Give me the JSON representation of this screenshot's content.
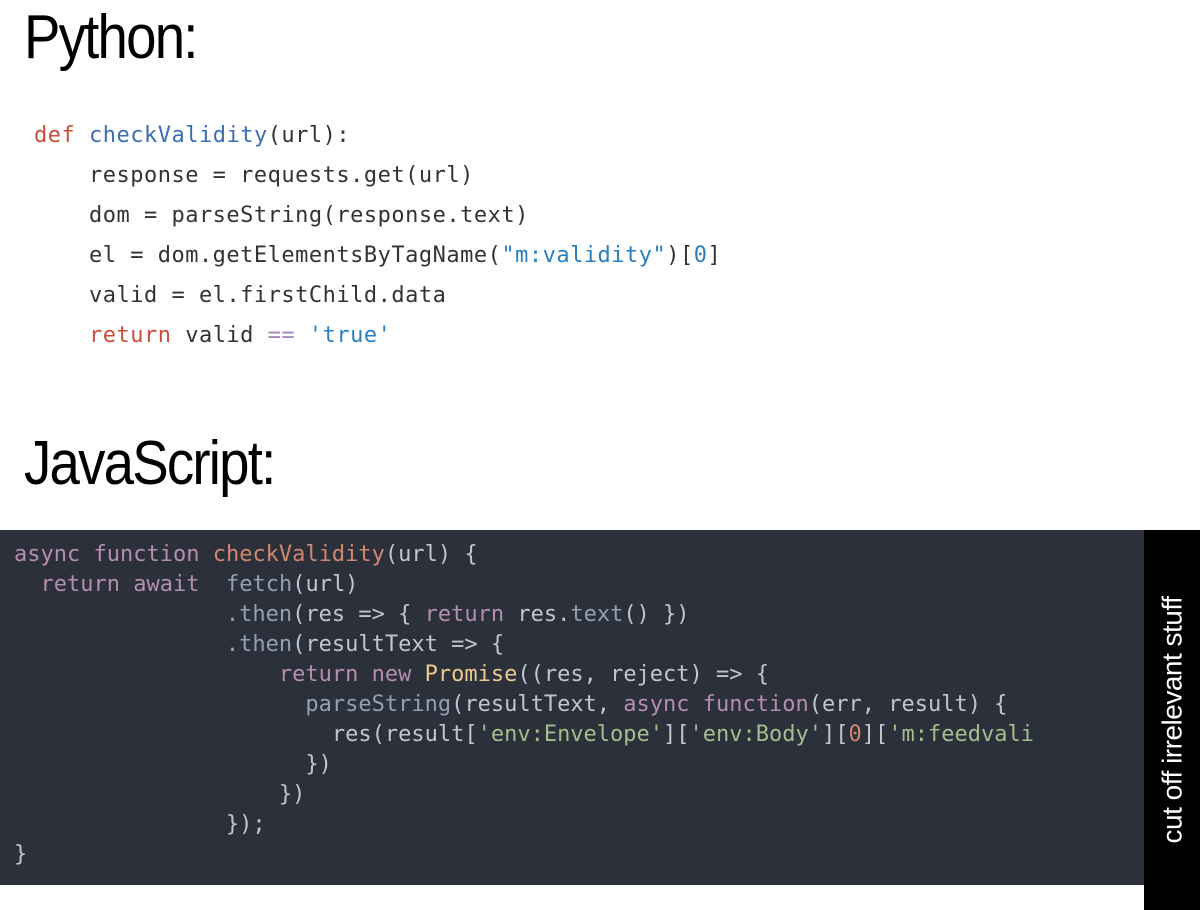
{
  "headings": {
    "python": "Python:",
    "javascript": "JavaScript:"
  },
  "python_code": {
    "line1": {
      "kw": "def",
      "fn": "checkValidity",
      "params": "(url):"
    },
    "line2": "    response = requests.get(url)",
    "line3": "    dom = parseString(response.text)",
    "line4_a": "    el = dom.getElementsByTagName(",
    "line4_str": "\"m:validity\"",
    "line4_b": ")[",
    "line4_num": "0",
    "line4_c": "]",
    "line5": "    valid = el.firstChild.data",
    "line6_kw": "    return",
    "line6_a": " valid ",
    "line6_op": "==",
    "line6_b": " ",
    "line6_str": "'true'"
  },
  "js_code": {
    "l1_async": "async",
    "l1_func": "function",
    "l1_name": "checkValidity",
    "l1_rest": "(url) {",
    "l2_ret": "return",
    "l2_await": "await",
    "l2_fetch": "fetch",
    "l2_rest": "(url)",
    "l3_then": ".then",
    "l3_a": "(res => { ",
    "l3_ret": "return",
    "l3_b": " res.",
    "l3_text": "text",
    "l3_c": "() })",
    "l4_then": ".then",
    "l4_a": "(resultText => {",
    "l5_ret": "return",
    "l5_new": "new",
    "l5_prom": "Promise",
    "l5_a": "((res, reject) => {",
    "l6_ps": "parseString",
    "l6_a": "(resultText, ",
    "l6_async": "async",
    "l6_func": "function",
    "l6_b": "(err, result) {",
    "l7_a": "res(result[",
    "l7_s1": "'env:Envelope'",
    "l7_b": "][",
    "l7_s2": "'env:Body'",
    "l7_c": "][",
    "l7_n": "0",
    "l7_d": "][",
    "l7_s3": "'m:feedvali",
    "l8": "})",
    "l9": "})",
    "l10": "});",
    "l11": "}"
  },
  "side_label": "cut off irrelevant stuff"
}
